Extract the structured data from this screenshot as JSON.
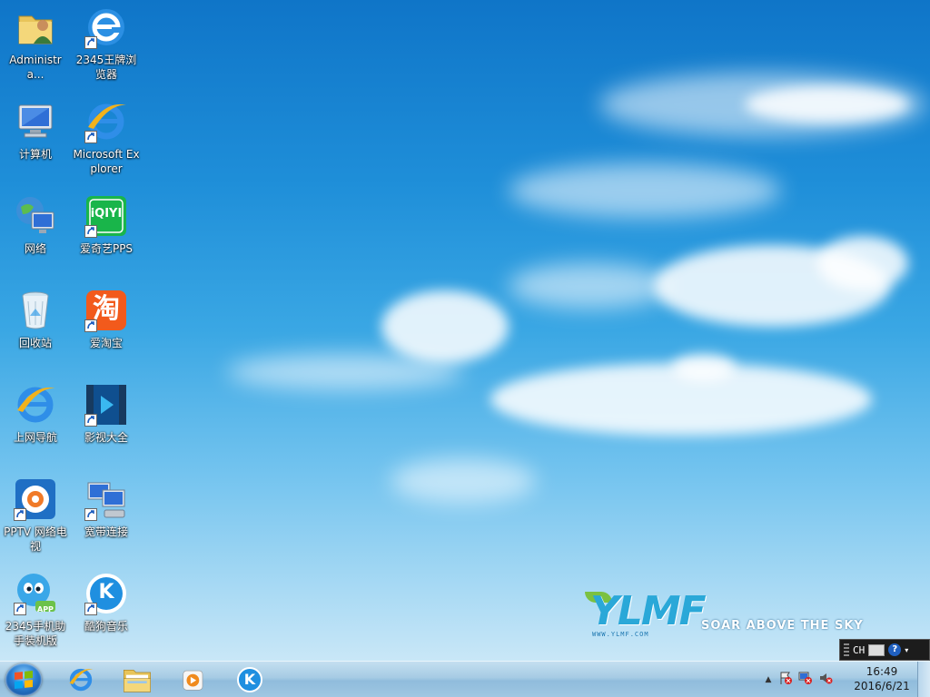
{
  "desktop": {
    "icons": [
      {
        "label": "Administra...",
        "icon": "user-folder-icon",
        "shortcut": false
      },
      {
        "label": "2345王牌浏览器",
        "icon": "browser-2345-icon",
        "shortcut": true
      },
      {
        "label": "计算机",
        "icon": "computer-icon",
        "shortcut": false
      },
      {
        "label": "Microsoft Explorer",
        "icon": "internet-explorer-icon",
        "shortcut": true
      },
      {
        "label": "网络",
        "icon": "network-icon",
        "shortcut": false
      },
      {
        "label": "爱奇艺PPS",
        "icon": "iqiyi-icon",
        "shortcut": true,
        "badge": "iQIYI"
      },
      {
        "label": "回收站",
        "icon": "recycle-bin-icon",
        "shortcut": false
      },
      {
        "label": "爱淘宝",
        "icon": "taobao-icon",
        "shortcut": true,
        "badge": "淘"
      },
      {
        "label": "上网导航",
        "icon": "ie-navigation-icon",
        "shortcut": false
      },
      {
        "label": "影视大全",
        "icon": "video-player-icon",
        "shortcut": true
      },
      {
        "label": "PPTV 网络电视",
        "icon": "pptv-icon",
        "shortcut": true
      },
      {
        "label": "宽带连接",
        "icon": "broadband-connection-icon",
        "shortcut": true
      },
      {
        "label": "2345手机助手装机版",
        "icon": "phone-assistant-icon",
        "shortcut": true,
        "badge": "APP"
      },
      {
        "label": "酷狗音乐",
        "icon": "kugou-music-icon",
        "shortcut": true,
        "badge": "K"
      }
    ]
  },
  "wallpaper": {
    "logo": "YLMF",
    "tagline": "SOAR ABOVE THE SKY",
    "url": "WWW.YLMF.COM"
  },
  "language_bar": {
    "lang": "CH",
    "help": "?"
  },
  "taskbar": {
    "start_icon": "windows-start-orb-icon",
    "pinned": [
      {
        "name": "internet-explorer-icon"
      },
      {
        "name": "file-explorer-icon"
      },
      {
        "name": "media-player-icon"
      },
      {
        "name": "kugou-music-icon",
        "badge": "K"
      }
    ],
    "tray_icons": [
      "show-hidden-icons-icon",
      "action-center-flag-icon",
      "network-disconnected-icon",
      "volume-muted-icon"
    ],
    "clock": {
      "time": "16:49",
      "date": "2016/6/21"
    }
  },
  "colors": {
    "sky_top": "#0f75c8",
    "sky_bottom": "#c9e7f7",
    "taskbar": "#a6cbe4",
    "logo_blue": "#2aa8d8",
    "logo_green": "#7bc142"
  }
}
